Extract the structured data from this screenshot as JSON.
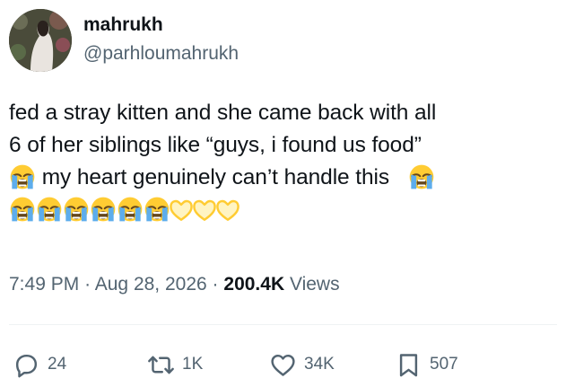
{
  "author": {
    "display_name": "mahrukh",
    "handle": "@parhloumahrukh",
    "avatar_icon": "profile-photo"
  },
  "tweet": {
    "line1": "fed a stray kitten and she came back with all",
    "line2": "6 of her siblings like “guys, i found us food”",
    "line3_text": "my heart genuinely can’t handle this",
    "emoji_cry": "loudly-crying-face",
    "emoji_heart": "yellow-heart-hands"
  },
  "meta": {
    "time": "7:49 PM",
    "separator": "·",
    "date": "Aug 28, 2026",
    "views_count": "200.4K",
    "views_label": "Views"
  },
  "actions": {
    "reply": {
      "count": "24",
      "icon": "reply-icon"
    },
    "retweet": {
      "count": "1K",
      "icon": "retweet-icon"
    },
    "like": {
      "count": "34K",
      "icon": "heart-icon"
    },
    "bookmark": {
      "count": "507",
      "icon": "bookmark-icon"
    }
  },
  "colors": {
    "text": "#0f1419",
    "secondary": "#536471",
    "divider": "#eff3f4",
    "emoji_yellow": "#ffcc33",
    "tear_blue": "#5dadec"
  }
}
